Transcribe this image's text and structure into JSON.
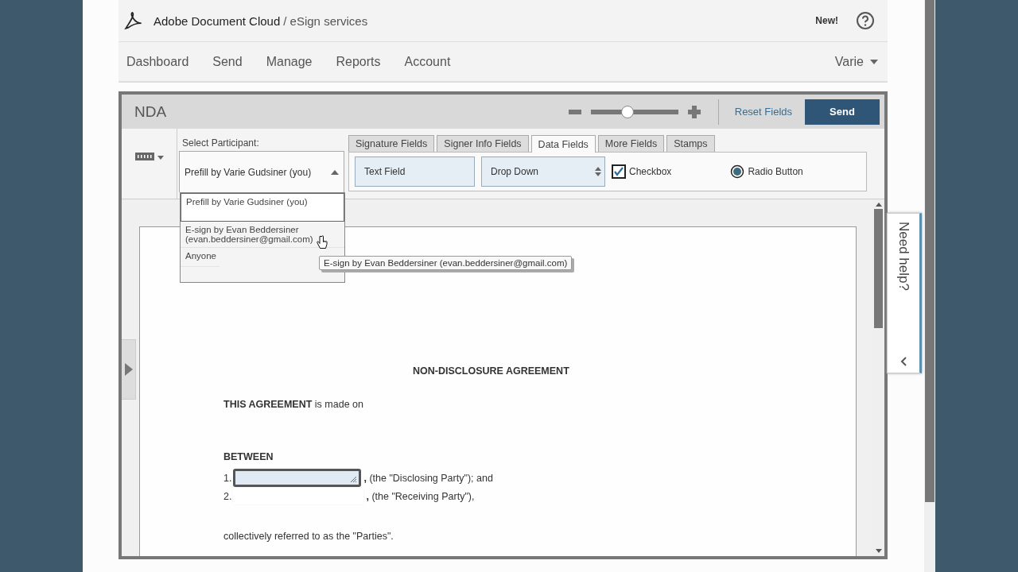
{
  "header": {
    "brand": "Adobe Document Cloud",
    "service": "/ eSign services",
    "new_label": "New!"
  },
  "nav": {
    "items": [
      {
        "label": "Dashboard"
      },
      {
        "label": "Send"
      },
      {
        "label": "Manage"
      },
      {
        "label": "Reports"
      },
      {
        "label": "Account"
      }
    ],
    "user": "Varie"
  },
  "editor": {
    "title": "NDA",
    "zoom": {
      "level": 0.42
    },
    "reset_label": "Reset Fields",
    "send_label": "Send"
  },
  "participant": {
    "label": "Select Participant:",
    "value": "Prefill by Varie Gudsiner (you)",
    "expanded": true,
    "options": [
      {
        "label": "Prefill by Varie Gudsiner (you)",
        "selected": true
      },
      {
        "label": "E-sign by Evan Beddersiner (evan.beddersiner@gmail.com)",
        "selected": false
      },
      {
        "label": "Anyone",
        "selected": false
      }
    ]
  },
  "tooltip": "E-sign by Evan Beddersiner (evan.beddersiner@gmail.com)",
  "tabs": [
    {
      "label": "Signature Fields",
      "selected": false
    },
    {
      "label": "Signer Info Fields",
      "selected": false
    },
    {
      "label": "Data Fields",
      "selected": true
    },
    {
      "label": "More Fields",
      "selected": false
    },
    {
      "label": "Stamps",
      "selected": false
    }
  ],
  "fields": [
    {
      "kind": "text",
      "label": "Text Field"
    },
    {
      "kind": "dropdown",
      "label": "Drop Down"
    },
    {
      "kind": "checkbox",
      "label": "Checkbox",
      "checked": true
    },
    {
      "kind": "radio",
      "label": "Radio Button",
      "checked": true
    }
  ],
  "document": {
    "title": "NON-DISCLOSURE AGREEMENT",
    "intro": "**THIS AGREEMENT** is made on",
    "between": "BETWEEN",
    "parties": [
      {
        "number": "1.",
        "has_field": true,
        "text": "**,** (the \"Disclosing Party\"); and"
      },
      {
        "number": "2.",
        "has_field": false,
        "text": "**,** (the \"Receiving Party\"),"
      }
    ],
    "closing": "collectively referred to as the \"Parties\"."
  },
  "help_tab": {
    "label": "Need help?"
  }
}
